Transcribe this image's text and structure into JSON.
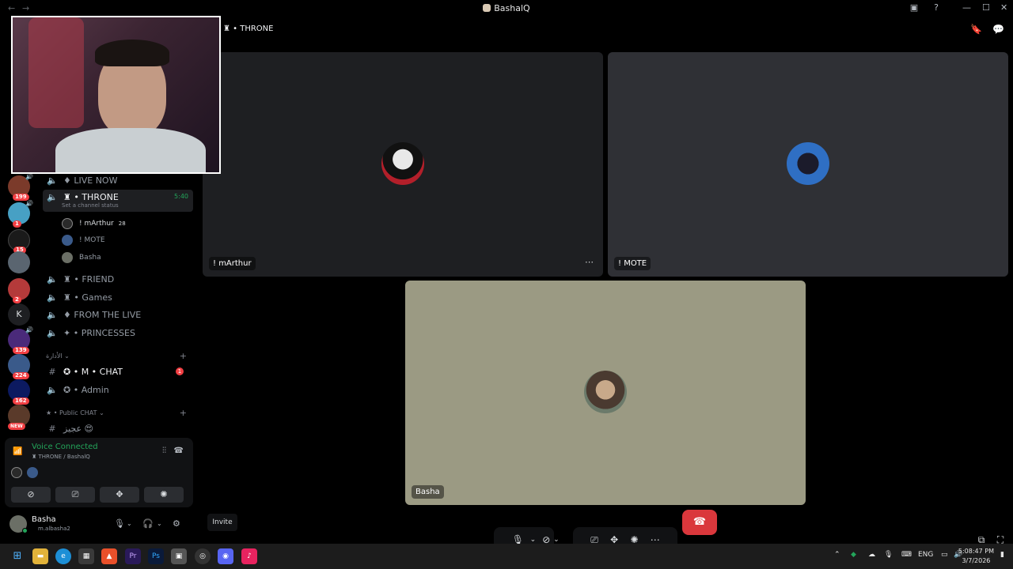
{
  "window": {
    "title": "BashalQ",
    "back_icon": "arrow-left-icon",
    "forward_icon": "arrow-right-icon"
  },
  "servers": [
    {
      "badge": "199",
      "has_voice": true
    },
    {
      "badge": "1",
      "has_voice": true
    },
    {
      "badge": "15",
      "has_voice": false
    },
    {
      "badge": "",
      "has_voice": false
    },
    {
      "badge": "2",
      "has_voice": false
    },
    {
      "letter": "K"
    },
    {
      "badge": "139",
      "has_voice": true
    },
    {
      "badge": "224",
      "has_voice": false
    },
    {
      "badge": "162",
      "has_voice": false
    },
    {
      "badge": "NEW",
      "has_voice": false
    }
  ],
  "channels": {
    "live_now": "♦ LIVE NOW",
    "throne": "♜ • THRONE",
    "throne_time": "5:40",
    "throne_status": "Set a channel status",
    "voice_users": [
      {
        "name": "! mArthur",
        "tag": "28"
      },
      {
        "name": "! MOTE"
      },
      {
        "name": "Basha"
      }
    ],
    "friend": "♜ • FRIEND",
    "games": "♜ • Games",
    "from_the_live": "♦ FROM THE LIVE",
    "princesses": "✦ • PRINCESSES",
    "category_admin": "الأدارة",
    "chat": "✪ • M • CHAT",
    "chat_unread": "1",
    "admin": "✪ • Admin",
    "category_public": "★ • Public CHAT",
    "public_text": "عجيز 😍"
  },
  "voice_panel": {
    "status": "Voice Connected",
    "location": "♜ THRONE / BashalQ"
  },
  "user": {
    "name": "Basha",
    "handle": "m.albasha2"
  },
  "main": {
    "channel_title": "♜ • THRONE",
    "tiles": [
      {
        "name": "! mArthur"
      },
      {
        "name": "! MOTE"
      },
      {
        "name": "Basha"
      }
    ],
    "invite": "Invite"
  },
  "taskbar": {
    "lang": "ENG",
    "time": "5:08:47 PM",
    "date": "3/7/2026"
  },
  "colors": {
    "accent_green": "#23a55a",
    "danger_red": "#da373c",
    "tile_dark": "#1e1f22",
    "tile_gray": "#2f3035",
    "tile_khaki": "#9b9a83"
  }
}
